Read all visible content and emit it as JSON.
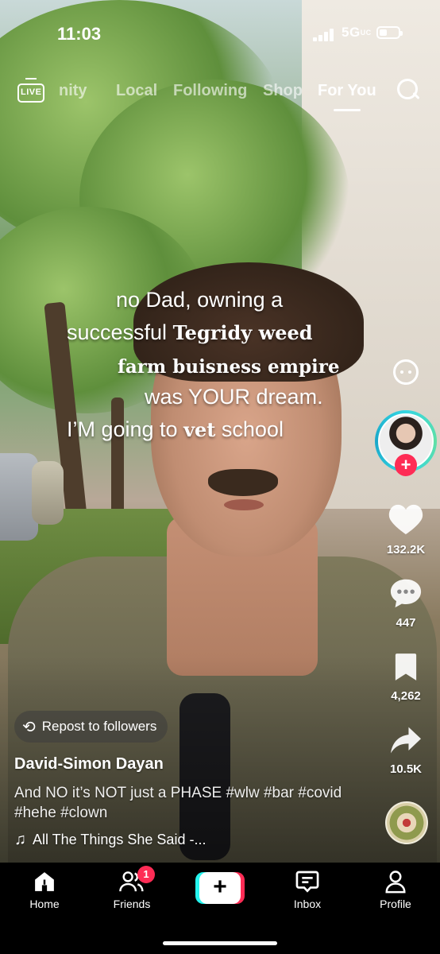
{
  "status_bar": {
    "time": "11:03",
    "network": "5G",
    "network_suffix": "UC"
  },
  "top_nav": {
    "live_label": "LIVE",
    "tabs": [
      {
        "label": "nity",
        "active": false
      },
      {
        "label": "Local",
        "active": false
      },
      {
        "label": "Following",
        "active": false
      },
      {
        "label": "Shop",
        "active": false
      },
      {
        "label": "For You",
        "active": true
      }
    ],
    "search_icon": "search-icon"
  },
  "caption": {
    "line1": "no Dad, owning a",
    "line2_a": "successful ",
    "line2_b": "Tegridy weed",
    "line3": "farm buisness empire",
    "line4": "was YOUR dream.",
    "line5_a": "I’M going to ",
    "line5_b": "vet",
    "line5_c": " school"
  },
  "actions": {
    "likes": "132.2K",
    "comments": "447",
    "saves": "4,262",
    "shares": "10.5K",
    "follow_icon": "plus-icon"
  },
  "post": {
    "repost_label": "Repost to followers",
    "author": "David-Simon Dayan",
    "description": "And NO it’s NOT just a PHASE #wlw #bar #covid #hehe #clown",
    "music": "All The Things She Said -..."
  },
  "tabbar": {
    "items": [
      {
        "label": "Home",
        "icon": "home-icon"
      },
      {
        "label": "Friends",
        "icon": "friends-icon",
        "badge": "1"
      },
      {
        "label": "",
        "icon": "plus-icon"
      },
      {
        "label": "Inbox",
        "icon": "inbox-icon"
      },
      {
        "label": "Profile",
        "icon": "profile-icon"
      }
    ]
  },
  "colors": {
    "accent_red": "#fe2c55",
    "accent_cyan": "#25f4ee"
  }
}
